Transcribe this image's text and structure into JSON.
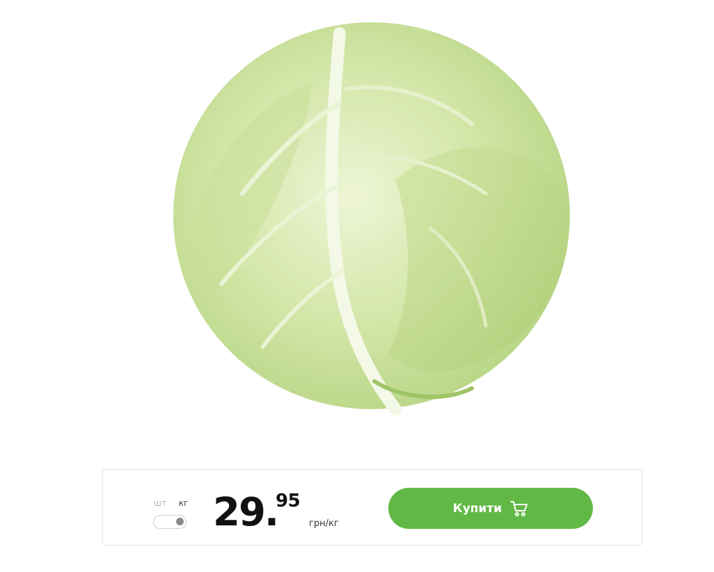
{
  "product": {
    "image_name": "cabbage-photo"
  },
  "units": {
    "pcs_label": "шт",
    "kg_label": "кг",
    "selected": "кг"
  },
  "price": {
    "integer": "29.",
    "fraction": "95",
    "unit": "грн/кг"
  },
  "buy_button": {
    "label": "Купити",
    "icon": "cart-icon"
  },
  "colors": {
    "accent_green": "#62b845"
  }
}
